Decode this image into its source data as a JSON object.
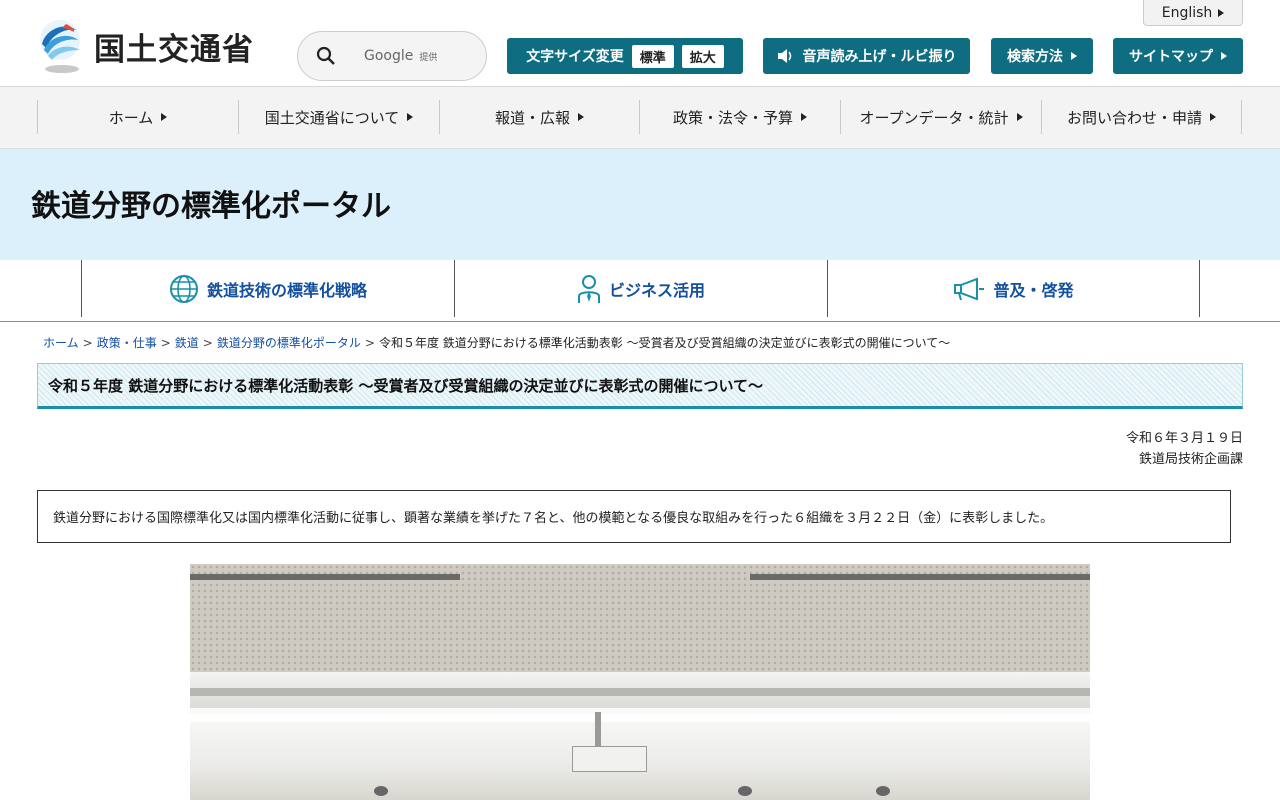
{
  "header": {
    "english_label": "English",
    "logo_text": "国土交通省",
    "search_provider": "Google",
    "search_provided": "提供",
    "font_size_label": "文字サイズ変更",
    "font_size_standard": "標準",
    "font_size_large": "拡大",
    "audio_label": "音声読み上げ・ルビ振り",
    "search_method_label": "検索方法",
    "sitemap_label": "サイトマップ"
  },
  "gnav": [
    {
      "label": "ホーム"
    },
    {
      "label": "国土交通省について"
    },
    {
      "label": "報道・広報"
    },
    {
      "label": "政策・法令・予算"
    },
    {
      "label": "オープンデータ・統計"
    },
    {
      "label": "お問い合わせ・申請"
    }
  ],
  "banner": {
    "title": "鉄道分野の標準化ポータル"
  },
  "portal_nav": [
    {
      "label": "鉄道技術の標準化戦略",
      "icon": "globe-icon"
    },
    {
      "label": "ビジネス活用",
      "icon": "person-icon"
    },
    {
      "label": "普及・啓発",
      "icon": "megaphone-icon"
    }
  ],
  "breadcrumb": {
    "items": [
      "ホーム",
      "政策・仕事",
      "鉄道",
      "鉄道分野の標準化ポータル"
    ],
    "current": "令和５年度 鉄道分野における標準化活動表彰 ～受賞者及び受賞組織の決定並びに表彰式の開催について～",
    "separator": ">"
  },
  "article": {
    "title": "令和５年度 鉄道分野における標準化活動表彰 ～受賞者及び受賞組織の決定並びに表彰式の開催について～",
    "date": "令和６年３月１９日",
    "department": "鉄道局技術企画課",
    "summary": "鉄道分野における国際標準化又は国内標準化活動に従事し、顕著な業績を挙げた７名と、他の模範となる優良な取組みを行った６組織を３月２２日（金）に表彰しました。"
  },
  "colors": {
    "teal_button": "#0f6d82",
    "banner_bg": "#dcf0fb",
    "link_blue": "#1450a0",
    "heading_rule": "#1a8fa8"
  }
}
